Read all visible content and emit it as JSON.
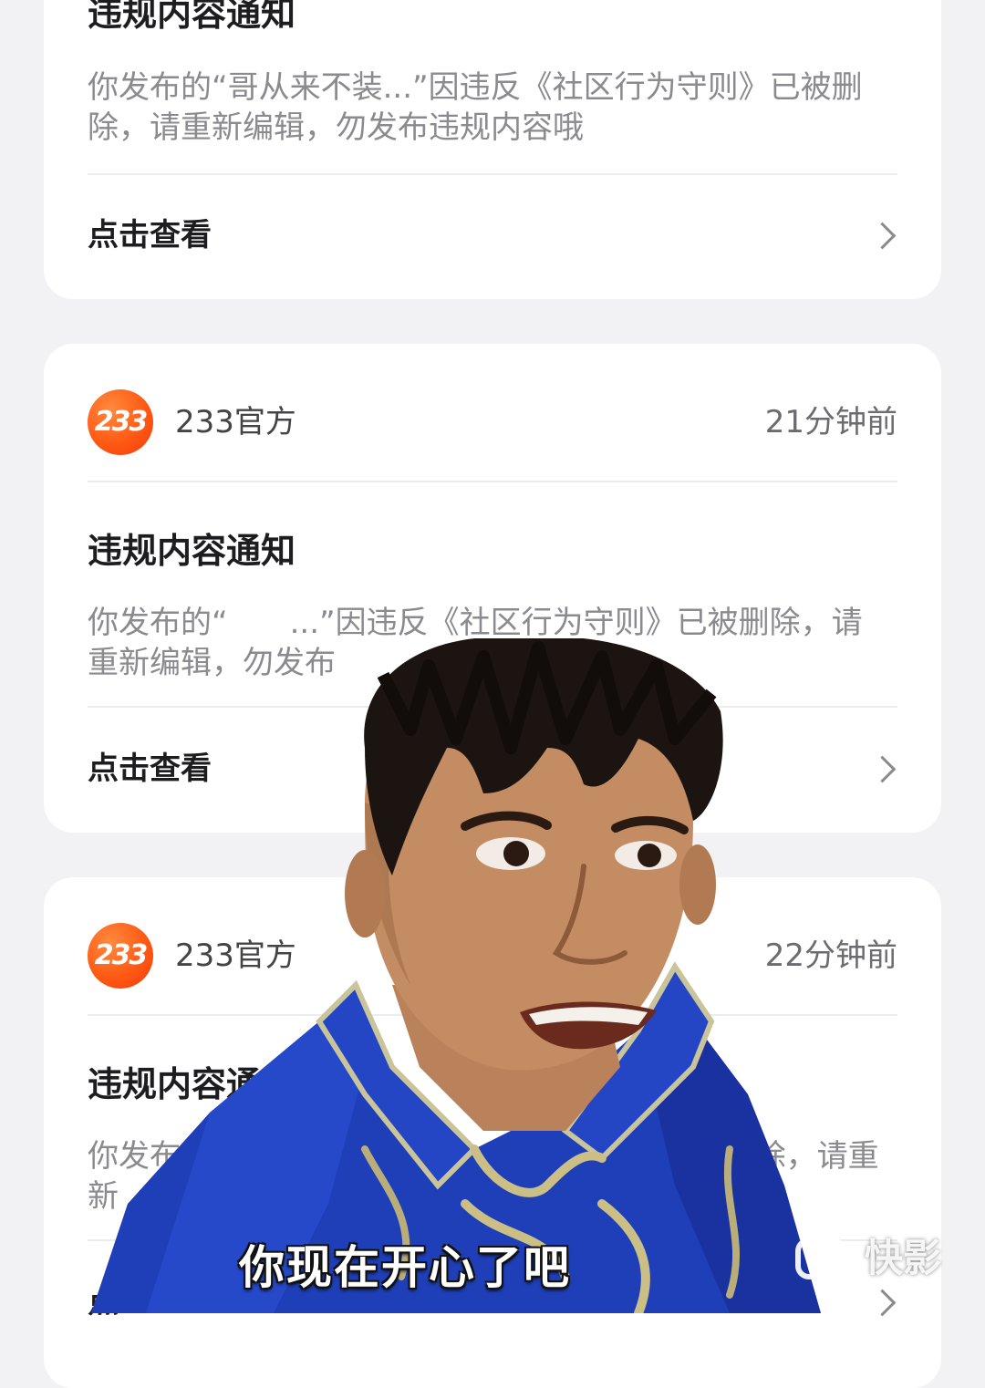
{
  "notifications": [
    {
      "title": "违规内容通知",
      "body": "你发布的“哥从来不装...”因违反《社区行为守则》已被删除，请重新编辑，勿发布违规内容哦",
      "action_label": "点击查看"
    },
    {
      "sender": "233官方",
      "logo_text": "233",
      "time": "21分钟前",
      "title": "违规内容通知",
      "body": "你发布的“　　...”因违反《社区行为守则》已被删除，请重新编辑，勿发布",
      "action_label": "点击查看"
    },
    {
      "sender": "233官方",
      "logo_text": "233",
      "time": "22分钟前",
      "title": "违规内容通知",
      "body": "你发布的“　　　　　　　　　　　　　　已被删除，请重新",
      "action_label": "点"
    }
  ],
  "overlay": {
    "caption": "你现在开心了吧",
    "watermark": "快影"
  },
  "colors": {
    "background": "#f2f2f4",
    "logo": "#ff5a14",
    "jacket": "#1f3fb8"
  }
}
